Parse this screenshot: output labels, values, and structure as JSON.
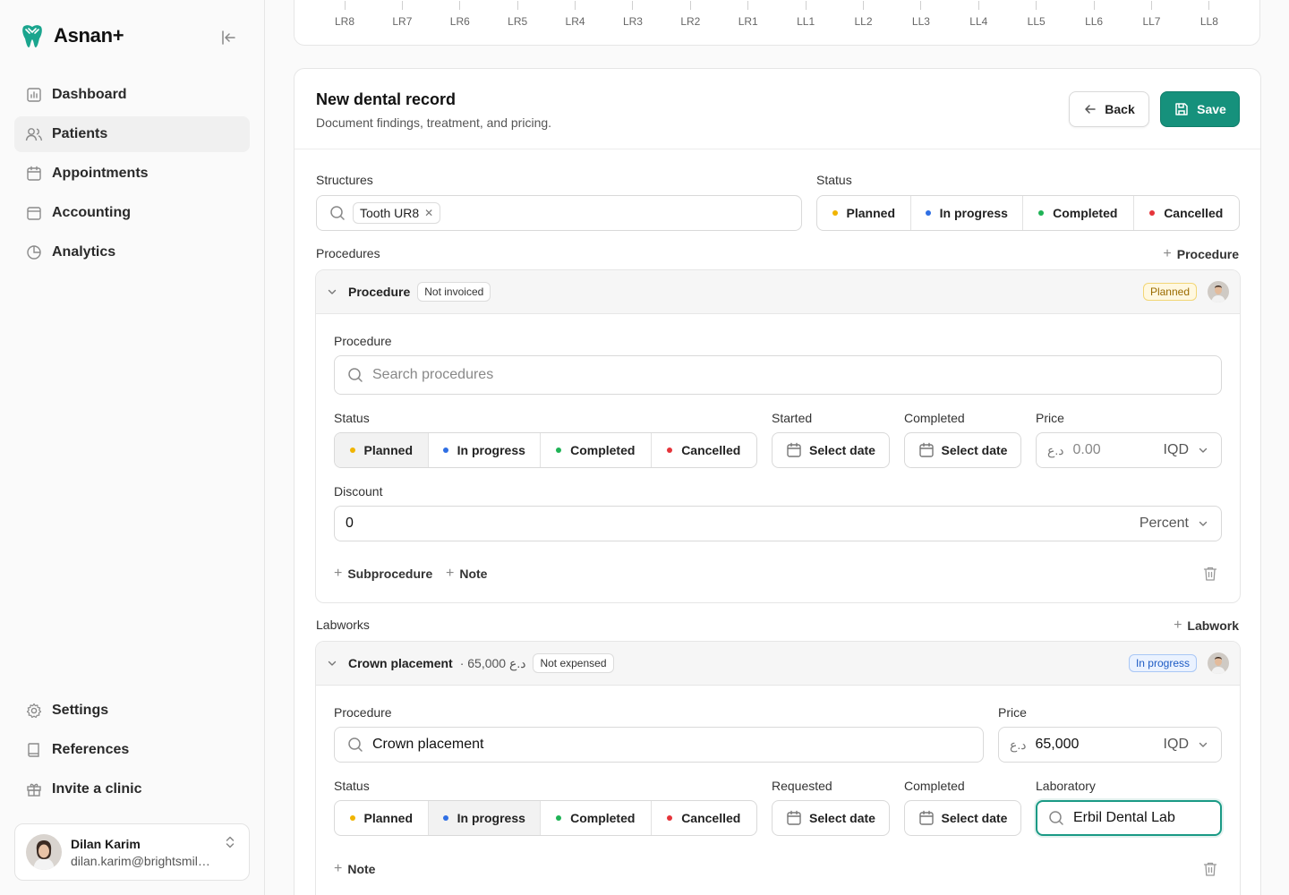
{
  "brand": {
    "name": "Asnan+",
    "accent": "#16917c"
  },
  "sidebar": {
    "top_items": [
      {
        "label": "Dashboard",
        "icon": "bar-chart-icon"
      },
      {
        "label": "Patients",
        "icon": "users-icon",
        "active": true
      },
      {
        "label": "Appointments",
        "icon": "calendar-icon"
      },
      {
        "label": "Accounting",
        "icon": "wallet-icon"
      },
      {
        "label": "Analytics",
        "icon": "pie-chart-icon"
      }
    ],
    "bottom_items": [
      {
        "label": "Settings",
        "icon": "gear-icon"
      },
      {
        "label": "References",
        "icon": "book-icon"
      },
      {
        "label": "Invite a clinic",
        "icon": "gift-icon"
      }
    ],
    "user": {
      "name": "Dilan Karim",
      "email": "dilan.karim@brightsmile.example.com"
    }
  },
  "tooth_chart": {
    "labels": [
      "LR8",
      "LR7",
      "LR6",
      "LR5",
      "LR4",
      "LR3",
      "LR2",
      "LR1",
      "LL1",
      "LL2",
      "LL3",
      "LL4",
      "LL5",
      "LL6",
      "LL7",
      "LL8"
    ]
  },
  "record": {
    "title": "New dental record",
    "subtitle": "Document findings, treatment, and pricing.",
    "back_label": "Back",
    "save_label": "Save",
    "structures_label": "Structures",
    "structure_chip": "Tooth UR8",
    "status_label": "Status",
    "status_options": [
      "Planned",
      "In progress",
      "Completed",
      "Cancelled"
    ],
    "status_colors": [
      "#f0b400",
      "#2f6fe4",
      "#1fb356",
      "#e5343a"
    ],
    "procedures_label": "Procedures",
    "add_procedure": "Procedure",
    "labworks_label": "Labworks",
    "add_labwork": "Labwork"
  },
  "procedure": {
    "head_title": "Procedure",
    "invoice_tag": "Not invoiced",
    "badge": "Planned",
    "procedure_label": "Procedure",
    "search_placeholder": "Search procedures",
    "status_label": "Status",
    "selected_status": "Planned",
    "started_label": "Started",
    "completed_label": "Completed",
    "select_date": "Select date",
    "price_label": "Price",
    "currency_symbol": "د.ع",
    "price_placeholder": "0.00",
    "currency_code": "IQD",
    "discount_label": "Discount",
    "discount_value": "0",
    "discount_unit": "Percent",
    "add_subprocedure": "Subprocedure",
    "add_note": "Note"
  },
  "labwork": {
    "head_title": "Crown placement",
    "head_price": "· 65,000 د.ع",
    "expense_tag": "Not expensed",
    "badge": "In progress",
    "procedure_label": "Procedure",
    "procedure_value": "Crown placement",
    "price_label": "Price",
    "currency_symbol": "د.ع",
    "price_value": "65,000",
    "currency_code": "IQD",
    "status_label": "Status",
    "selected_status": "In progress",
    "requested_label": "Requested",
    "completed_label": "Completed",
    "select_date": "Select date",
    "laboratory_label": "Laboratory",
    "laboratory_value": "Erbil Dental Lab",
    "add_note": "Note"
  }
}
